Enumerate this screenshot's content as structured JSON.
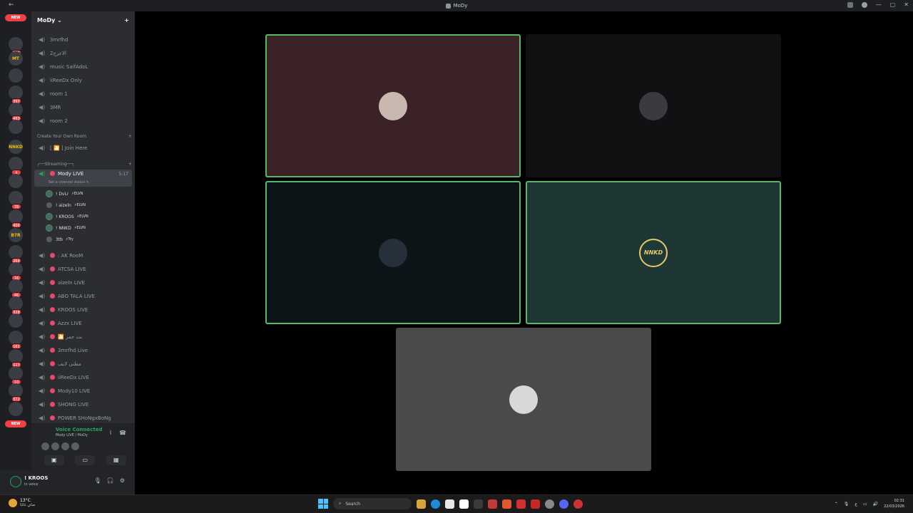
{
  "window": {
    "title": "MoDy",
    "back_glyph": "←"
  },
  "server": {
    "name": "MoDy",
    "dropdown_glyph": "⌄",
    "add_member_glyph": "+"
  },
  "guild_rail": [
    {
      "type": "new",
      "label": "NEW"
    },
    {
      "badge": "254"
    },
    {
      "text": "MT"
    },
    {
      "badge": ""
    },
    {
      "badge": "397"
    },
    {
      "badge": "463"
    },
    {
      "badge": ""
    },
    {
      "text": "NNKD"
    },
    {
      "badge": "4"
    },
    {
      "badge": ""
    },
    {
      "badge": "78"
    },
    {
      "badge": "406"
    },
    {
      "text": "B7R"
    },
    {
      "badge": "264"
    },
    {
      "badge": "16"
    },
    {
      "badge": "46"
    },
    {
      "badge": "328"
    },
    {
      "badge": ""
    },
    {
      "badge": "161"
    },
    {
      "badge": "117"
    },
    {
      "badge": "10"
    },
    {
      "badge": "372"
    },
    {
      "badge": ""
    },
    {
      "type": "new",
      "label": "NEW"
    }
  ],
  "channels_top": [
    "3mrfhd",
    "الاعرج2",
    "music SaifAdoL",
    "iiReeDx Only",
    "room 1",
    "3MR",
    "room 2"
  ],
  "category_create": {
    "label": "Create Your Own Room",
    "add": "+"
  },
  "join_here": "[ 🎦 ] Join Here",
  "category_streaming": {
    "label": "┌──Streaming──┐",
    "add": "+"
  },
  "active_channel": {
    "name": "Mody LIVE",
    "time": "5:17",
    "status": "Set a channel status ✎"
  },
  "members": [
    {
      "name": "! DvLr",
      "tag": "⚡ELVN",
      "speaking": true
    },
    {
      "name": "! aizeln",
      "tag": "⚡ELVN",
      "speaking": false
    },
    {
      "name": "! KROOS",
      "tag": "⚡ELVN",
      "speaking": true
    },
    {
      "name": "! NNKD",
      "tag": "⚡ELVN",
      "speaking": true
    },
    {
      "name": "3tb",
      "tag": "⚡Try",
      "speaking": false
    }
  ],
  "channels_live": [
    ": AK RooM",
    "ATCSA LIVE",
    "aizeln LIVE",
    "ABO TALA LIVE",
    "KROOS LIVE",
    "Azzx LIVE",
    "🎦 بث جمر",
    "3mrfhd Live",
    "مطنى لايف",
    "iiReeDx LIVE",
    "Mody10 LIVE",
    "SHONG LIVE",
    "POWER SHoNgxBoNg"
  ],
  "voice_panel": {
    "status": "Voice Connected",
    "channel": "Mody LIVE / MoDy"
  },
  "user": {
    "name": "! KROOS",
    "status": "In voice"
  },
  "tiles": [
    {
      "name": "tile-dvlr",
      "bg": "#3b2226",
      "speaking": true,
      "avatar": "#c8b8b0"
    },
    {
      "name": "tile-aizeln",
      "bg": "#111114",
      "speaking": false,
      "avatar": "#3a3a40"
    },
    {
      "name": "tile-kroos",
      "bg": "#0d1418",
      "speaking": true,
      "avatar": "#26303a"
    },
    {
      "name": "tile-nnkd",
      "bg": "#1e3634",
      "speaking": true,
      "avatar": "NNKD"
    },
    {
      "name": "tile-3tb",
      "bg": "#4a4a4a",
      "speaking": false,
      "avatar": "#d8d8d8"
    }
  ],
  "taskbar": {
    "weather_temp": "13°C",
    "weather_desc": "صافٍ غالبًا",
    "search_label": "Search",
    "lang": "ع",
    "time": "02:31",
    "date": "22/03/2026"
  }
}
